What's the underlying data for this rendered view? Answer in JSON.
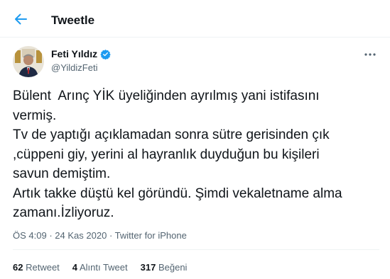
{
  "header": {
    "title": "Tweetle",
    "back_icon": "arrow-left-icon"
  },
  "tweet": {
    "author_name": "Feti Yıldız",
    "verified_icon": "verified-badge-icon",
    "handle": "@YildizFeti",
    "more_icon": "more-horizontal-icon",
    "text_lines": [
      "Bülent  Arınç YİK üyeliğinden ayrılmış yani istifasını",
      "vermiş.",
      "Tv de yaptığı açıklamadan sonra sütre gerisinden çık",
      ",cüppeni giy, yerini al hayranlık duyduğun bu kişileri",
      "savun demiştim.",
      "Artık takke düştü kel göründü. Şimdi vekaletname alma",
      "zamanı.İzliyoruz."
    ],
    "time": "ÖS 4:09",
    "date": "24 Kas 2020",
    "source": "Twitter for iPhone",
    "separator": "·"
  },
  "stats": {
    "retweets_count": "62",
    "retweets_label": "Retweet",
    "quotes_count": "4",
    "quotes_label": "Alıntı Tweet",
    "likes_count": "317",
    "likes_label": "Beğeni"
  },
  "colors": {
    "accent": "#1d9bf0",
    "text": "#0f1419",
    "secondary": "#536471",
    "divider": "#eff3f4"
  }
}
